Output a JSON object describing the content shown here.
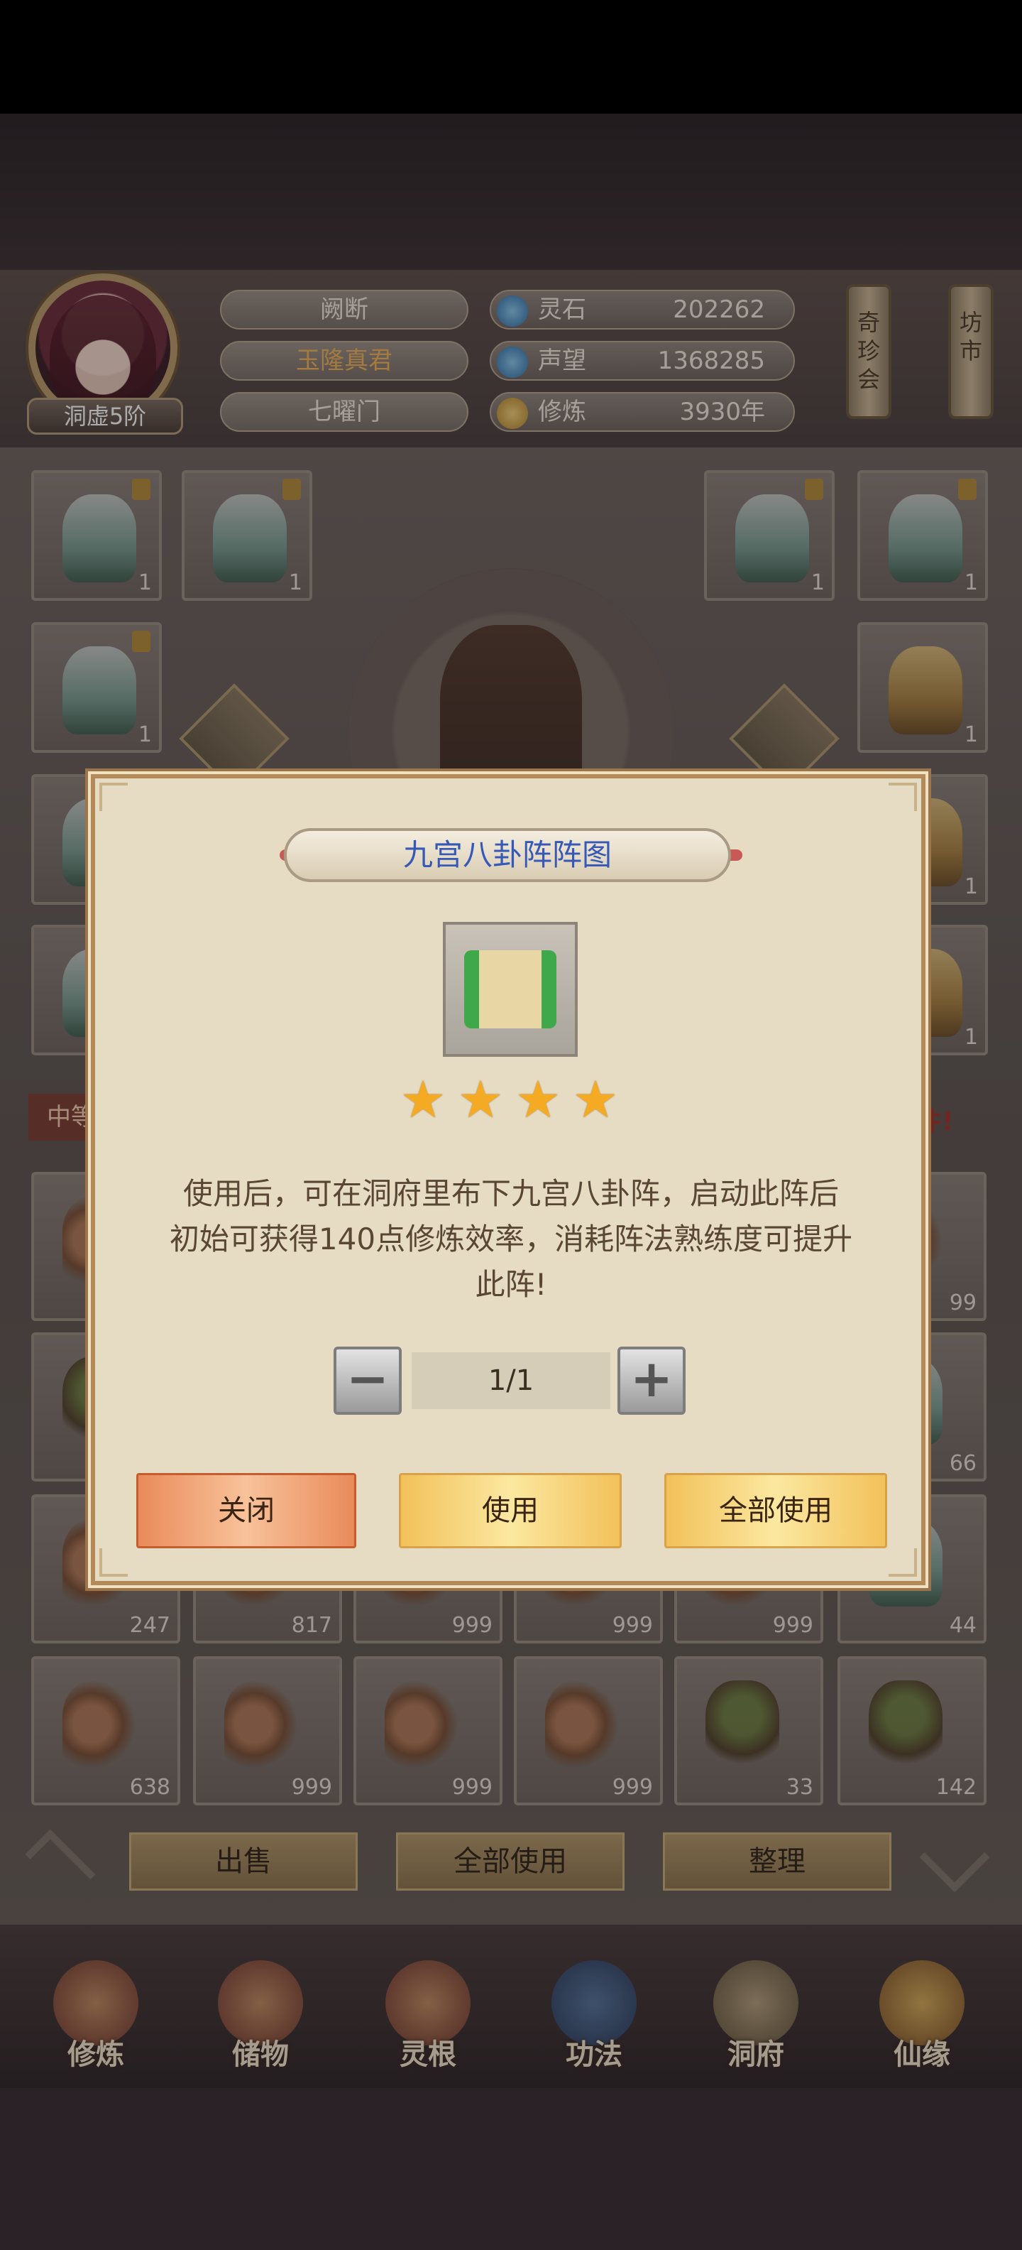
{
  "player": {
    "rank": "洞虚5阶",
    "name_line1": "阙断",
    "title": "玉隆真君",
    "sect": "七曜门"
  },
  "resources": [
    {
      "label": "灵石",
      "value": "202262",
      "icon": "spirit-stone-icon"
    },
    {
      "label": "声望",
      "value": "1368285",
      "icon": "reputation-icon"
    },
    {
      "label": "修炼",
      "value": "3930年",
      "icon": "cultivation-icon"
    }
  ],
  "side_buttons": {
    "treasure_fair": "奇珍会",
    "market": "坊市"
  },
  "bag": {
    "label": "中等",
    "banner_right": "多件!",
    "row3_counts": [
      "247",
      "817",
      "999",
      "999",
      "999",
      "44"
    ],
    "row4_counts": [
      "638",
      "999",
      "999",
      "999",
      "33",
      "142"
    ],
    "row2_counts": [
      "99",
      "66"
    ],
    "equip_counts": [
      "1",
      "1",
      "1",
      "1",
      "1",
      "1",
      "1",
      "1"
    ]
  },
  "bottom_buttons": {
    "sell": "出售",
    "use_all": "全部使用",
    "sort": "整理"
  },
  "nav": [
    "修炼",
    "储物",
    "灵根",
    "功法",
    "洞府",
    "仙缘"
  ],
  "modal": {
    "title": "九宫八卦阵阵图",
    "stars": 4,
    "star_glyph": "★",
    "description": [
      "使用后，可在洞府里布下九宫八卦阵，启动此阵后",
      "初始可获得140点修炼效率，消耗阵法熟练度可提升",
      "此阵!"
    ],
    "quantity": "1/1",
    "minus": "−",
    "plus": "+",
    "buttons": {
      "close": "关闭",
      "use": "使用",
      "use_all": "全部使用"
    }
  },
  "colors": {
    "title_text": "#3659b8",
    "star": "#f4ab23",
    "gold_name": "#f0b35a",
    "bag_alert": "#a4332a"
  }
}
